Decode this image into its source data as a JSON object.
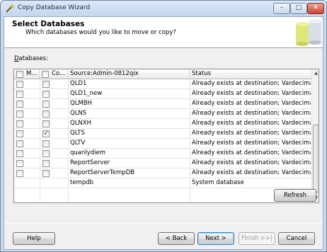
{
  "window": {
    "title": "Copy Database Wizard",
    "min_glyph": "–",
    "max_glyph": "□",
    "close_glyph": "✕"
  },
  "header": {
    "title": "Select Databases",
    "subtitle": "Which databases would you like to move or copy?"
  },
  "databases_label_mnemonic": "D",
  "databases_label_rest": "atabases:",
  "grid": {
    "columns": [
      "M...",
      "Co...",
      "Source:Admin-0812qix",
      "Status"
    ],
    "rows": [
      {
        "move": false,
        "copy": false,
        "name": "QLD1",
        "status": "Already exists at destination; Vardecimal storag..."
      },
      {
        "move": false,
        "copy": false,
        "name": "QLD1_new",
        "status": "Already exists at destination; Vardecimal storag..."
      },
      {
        "move": false,
        "copy": false,
        "name": "QLMBH",
        "status": "Already exists at destination; Vardecimal storag..."
      },
      {
        "move": false,
        "copy": false,
        "name": "QLNS",
        "status": "Already exists at destination; Vardecimal storag..."
      },
      {
        "move": false,
        "copy": false,
        "name": "QLNXH",
        "status": "Already exists at destination; Vardecimal storag..."
      },
      {
        "move": false,
        "copy": true,
        "name": "QLTS",
        "status": "Already exists at destination; Vardecimal storag..."
      },
      {
        "move": false,
        "copy": false,
        "name": "QLTV",
        "status": "Already exists at destination; Vardecimal storag..."
      },
      {
        "move": false,
        "copy": false,
        "name": "quanlydiem",
        "status": "Already exists at destination; Vardecimal storag..."
      },
      {
        "move": false,
        "copy": false,
        "name": "ReportServer",
        "status": "Already exists at destination; Vardecimal storag..."
      },
      {
        "move": false,
        "copy": false,
        "name": "ReportServerTempDB",
        "status": "Already exists at destination; Vardecimal storag..."
      },
      {
        "move": null,
        "copy": null,
        "name": "tempdb",
        "status": "System database"
      }
    ],
    "check_glyph": "✓"
  },
  "buttons": {
    "refresh": "Refresh",
    "help": "Help",
    "back": "< Back",
    "next": "Next >",
    "finish": "Finish >>|",
    "cancel": "Cancel"
  },
  "colors": {
    "accent": "#3c7fb1",
    "checkmark": "#21357a"
  }
}
